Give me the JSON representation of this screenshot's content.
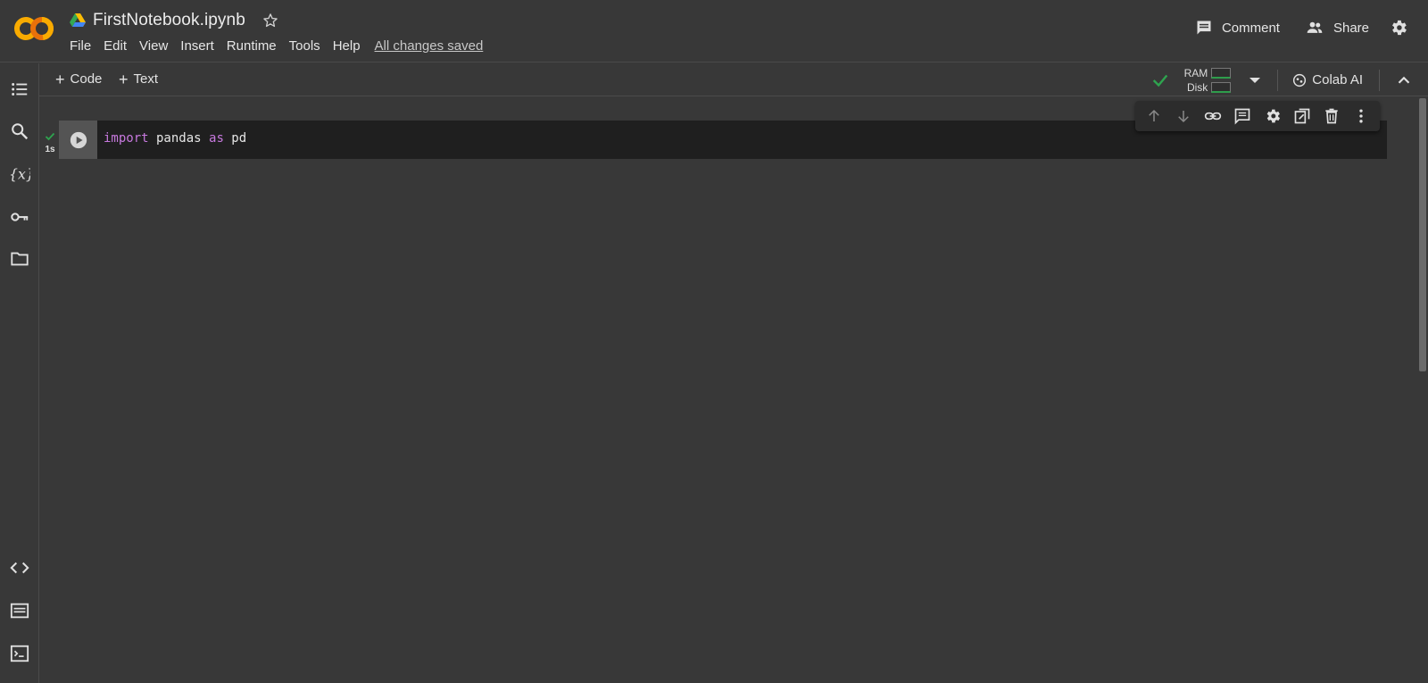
{
  "header": {
    "notebook_title": "FirstNotebook.ipynb",
    "menu": [
      "File",
      "Edit",
      "View",
      "Insert",
      "Runtime",
      "Tools",
      "Help"
    ],
    "save_status": "All changes saved",
    "comment_label": "Comment",
    "share_label": "Share"
  },
  "toolbar": {
    "add_code_label": "Code",
    "add_text_label": "Text",
    "ram_label": "RAM",
    "disk_label": "Disk",
    "colab_ai_label": "Colab AI"
  },
  "rail": {
    "icons": [
      "table-of-contents-icon",
      "search-icon",
      "variables-icon",
      "secrets-key-icon",
      "files-folder-icon",
      "code-snippets-icon",
      "command-palette-icon",
      "terminal-icon"
    ]
  },
  "cell": {
    "exec_time": "1s",
    "code_tokens": [
      {
        "text": "import",
        "kind": "keyword"
      },
      {
        "text": " pandas ",
        "kind": "plain"
      },
      {
        "text": "as",
        "kind": "keyword"
      },
      {
        "text": " pd",
        "kind": "plain"
      }
    ]
  },
  "colors": {
    "background": "#383838",
    "cell_background": "#1f1f1f",
    "keyword": "#c678dd",
    "success_green": "#2e9d4b",
    "logo_orange": "#f9ab00"
  }
}
